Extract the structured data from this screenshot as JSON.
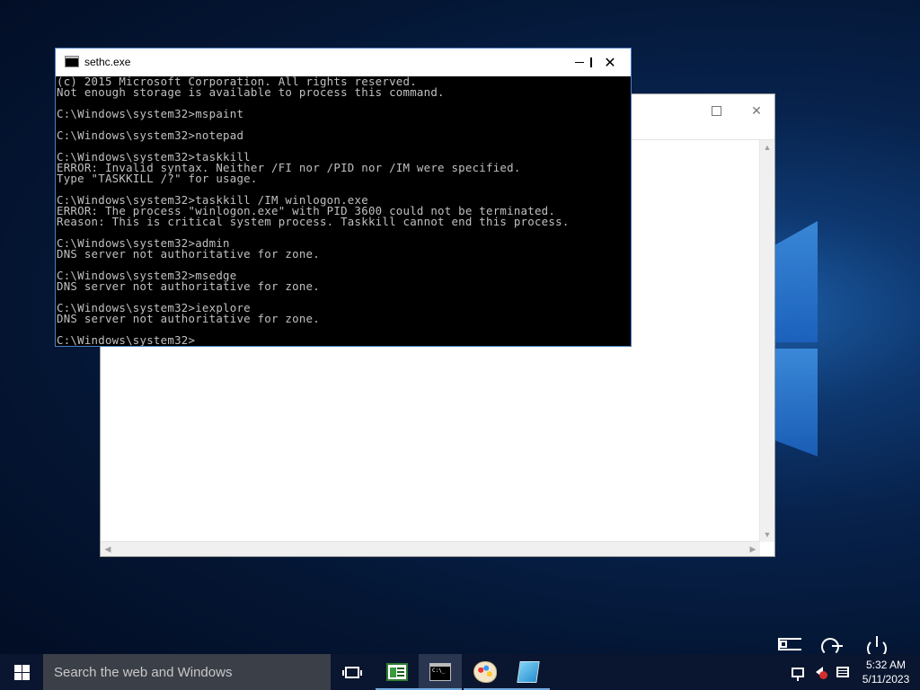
{
  "cmd_window": {
    "title": "sethc.exe",
    "lines": [
      "(c) 2015 Microsoft Corporation. All rights reserved.",
      "Not enough storage is available to process this command.",
      "",
      "C:\\Windows\\system32>mspaint",
      "",
      "C:\\Windows\\system32>notepad",
      "",
      "C:\\Windows\\system32>taskkill",
      "ERROR: Invalid syntax. Neither /FI nor /PID nor /IM were specified.",
      "Type \"TASKKILL /?\" for usage.",
      "",
      "C:\\Windows\\system32>taskkill /IM winlogon.exe",
      "ERROR: The process \"winlogon.exe\" with PID 3600 could not be terminated.",
      "Reason: This is critical system process. Taskkill cannot end this process.",
      "",
      "C:\\Windows\\system32>admin",
      "DNS server not authoritative for zone.",
      "",
      "C:\\Windows\\system32>msedge",
      "DNS server not authoritative for zone.",
      "",
      "C:\\Windows\\system32>iexplore",
      "DNS server not authoritative for zone.",
      "",
      "C:\\Windows\\system32>"
    ]
  },
  "taskbar": {
    "search_placeholder": "Search the web and Windows",
    "time": "5:32 AM",
    "date": "5/11/2023"
  },
  "colors": {
    "console_bg": "#000000",
    "console_fg": "#c0c0c0",
    "taskbar_bg": "#0a1630",
    "accent": "#6fa8dc"
  }
}
